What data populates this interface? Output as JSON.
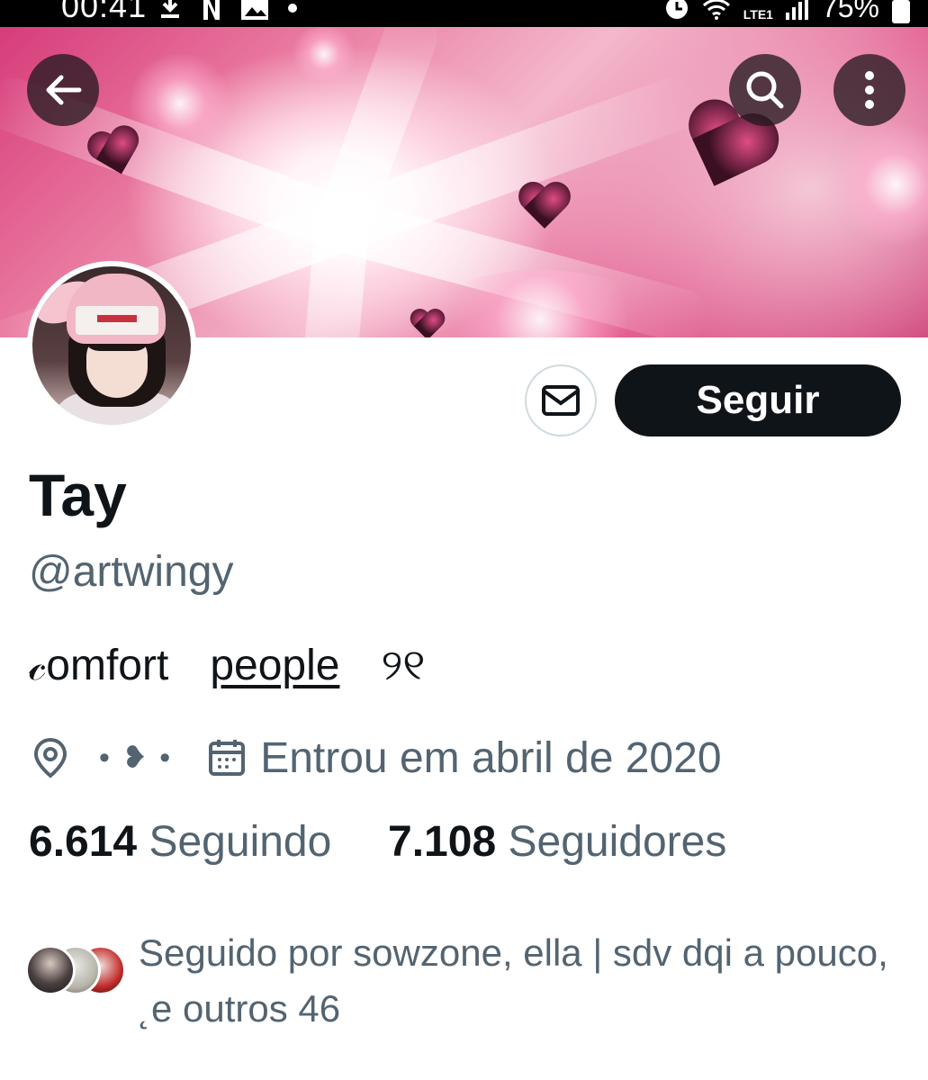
{
  "status_bar": {
    "time": "00:41",
    "network": "LTE1",
    "battery": "75%",
    "icons": [
      "download-icon",
      "netflix-icon",
      "gallery-icon",
      "dot-icon",
      "alarm-icon",
      "wifi-icon",
      "signal-icon",
      "battery-icon"
    ]
  },
  "header": {
    "back_icon": "arrow-left-icon",
    "search_icon": "search-icon",
    "more_icon": "more-vertical-icon"
  },
  "profile": {
    "display_name": "Tay",
    "handle": "@artwingy",
    "bio_words": [
      "𝒸omfort",
      "people",
      "୨୧"
    ],
    "location": "• ❥ •",
    "joined": "Entrou em abril de 2020",
    "following_count": "6.614",
    "following_label": "Seguindo",
    "followers_count": "7.108",
    "followers_label": "Seguidores",
    "followed_by": "Seguido por sowzone, ella | sdv dqi a pouco, ˛e outros 46"
  },
  "actions": {
    "follow_label": "Seguir",
    "message_icon": "envelope-icon"
  },
  "colors": {
    "primary_text": "#0f1419",
    "secondary_text": "#536471",
    "button_bg": "#0f1419",
    "border": "#cfd9de"
  }
}
